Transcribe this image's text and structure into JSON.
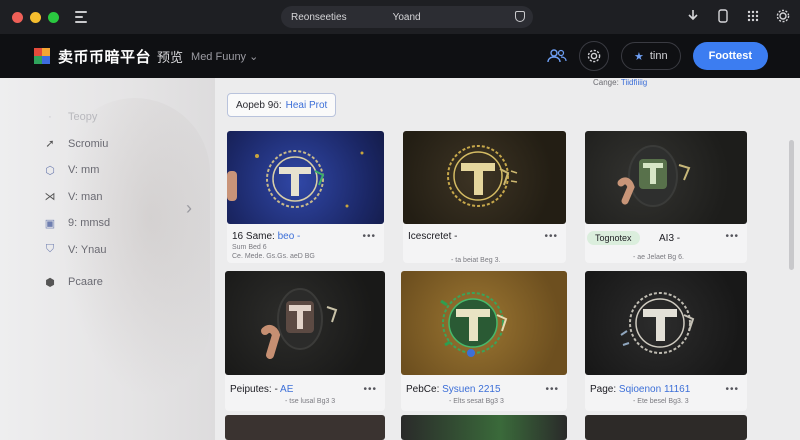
{
  "window": {
    "address_left": "Reonseeties",
    "address_right": "Yoand"
  },
  "header": {
    "brand": "卖币币暗平台",
    "brand_sub": "预览",
    "user_label": "Med Fuuny",
    "pill_label": "tinn",
    "cta_label": "Foottest",
    "accent": "#3c7df1"
  },
  "sidebar": {
    "items": [
      {
        "label": "Teopy",
        "icon": "dot-icon"
      },
      {
        "label": "Scromiu",
        "icon": "arrow-icon"
      },
      {
        "label": "V: mm",
        "icon": "badge-icon"
      },
      {
        "label": "V: man",
        "icon": "brackets-icon"
      },
      {
        "label": "9: mmsd",
        "icon": "card-icon"
      },
      {
        "label": "V: Ynau",
        "icon": "shield-icon"
      },
      {
        "label": "Pcaare",
        "icon": "cube-icon"
      }
    ]
  },
  "main": {
    "filter_prefix": "Aopeb 9ö:",
    "filter_value": "Heai Prot",
    "top_peek_text": "Cange:",
    "top_peek_link": "Tiidfiiiig",
    "cards": [
      {
        "title": "16 Same:",
        "title_hl": "beo -",
        "meta1": "Sum Bed 6",
        "meta2": "Ce. Mede. Gs.Gs. aeD BG",
        "bg": "#1e2a6b"
      },
      {
        "title": "Icescretet -",
        "title_hl": "",
        "meta1": "- ta beiat Beg 3.",
        "meta2": "",
        "bg": "#2a2418"
      },
      {
        "title": "Tognotex",
        "title_hl": "AI3 -",
        "meta1": "- ae Jelaet Bg 6.",
        "meta2": "",
        "bg": "#252521",
        "tag": true
      },
      {
        "title": "Peiputes: -",
        "title_hl": "AE",
        "meta1": "- tse lusal Bg3 3",
        "meta2": "",
        "bg": "#1d1d1c"
      },
      {
        "title": "PebCe:",
        "title_hl": "Sysuen 2215",
        "meta1": "- Elts sesat Bg3 3",
        "meta2": "",
        "bg": "#7a5a25"
      },
      {
        "title": "Page:",
        "title_hl": "Sqioenon 11161",
        "meta1": "- Ete besel Bg3. 3",
        "meta2": "",
        "bg": "#1f1f1f"
      }
    ]
  }
}
